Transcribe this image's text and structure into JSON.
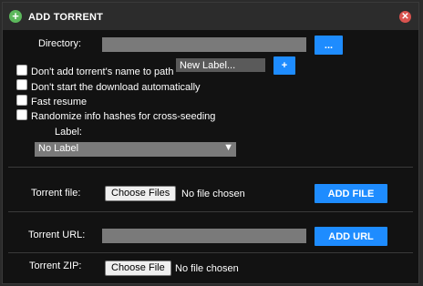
{
  "dialog": {
    "title": "ADD TORRENT",
    "title_icon": "plus-circle-icon",
    "close_icon": "close-icon"
  },
  "directory": {
    "label": "Directory:",
    "value": "",
    "browse_label": "..."
  },
  "options": {
    "no_name_in_path": {
      "label": "Don't add torrent's name to path",
      "checked": false
    },
    "no_autostart": {
      "label": "Don't start the download automatically",
      "checked": false
    },
    "fast_resume": {
      "label": "Fast resume",
      "checked": false
    },
    "randomize_hashes": {
      "label": "Randomize info hashes for cross-seeding",
      "checked": false
    }
  },
  "new_label": {
    "placeholder": "New Label...",
    "add_label": "+"
  },
  "label_select": {
    "label": "Label:",
    "selected": "No Label"
  },
  "torrent_file": {
    "label": "Torrent file:",
    "choose_label": "Choose Files",
    "status": "No file chosen",
    "add_label": "ADD FILE"
  },
  "torrent_url": {
    "label": "Torrent URL:",
    "value": "",
    "add_label": "ADD URL"
  },
  "torrent_zip": {
    "label": "Torrent ZIP:",
    "choose_label": "Choose File",
    "status": "No file chosen"
  },
  "colors": {
    "accent": "#1e8cff",
    "title_icon": "#5cb85c",
    "close": "#d9534f"
  }
}
